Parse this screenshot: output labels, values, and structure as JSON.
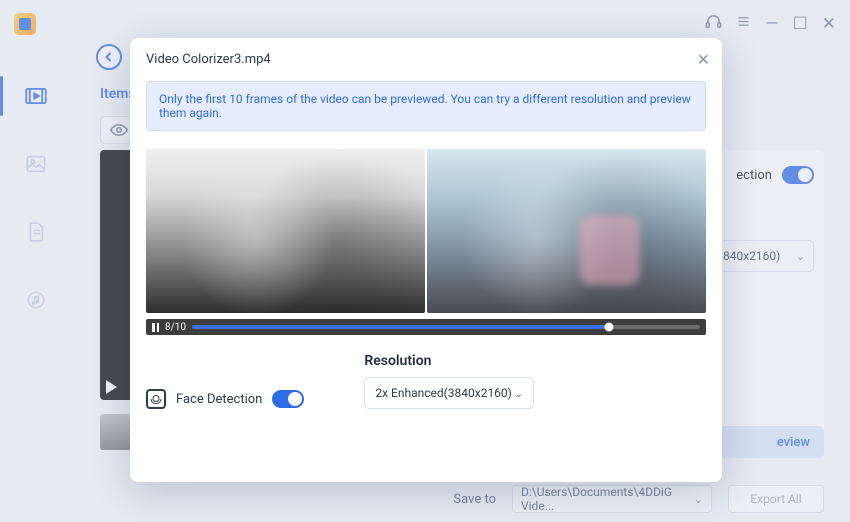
{
  "titlebar": {
    "min": "—",
    "max": "☐",
    "close": "✕"
  },
  "back": "<",
  "items_label": "Items",
  "right_panel": {
    "face_detection_partial": "ection",
    "resolution_partial": "840x2160)"
  },
  "preview_partial": "eview",
  "bottom": {
    "save_label": "Save to",
    "save_path": "D:\\Users\\Documents\\4DDiG Vide...",
    "export": "Export All"
  },
  "modal": {
    "title": "Video Colorizer3.mp4",
    "close": "✕",
    "banner": "Only the first 10 frames of the video can be previewed. You can try a different resolution and preview them again.",
    "frame_count": "8/10",
    "face_detection": "Face Detection",
    "resolution_label": "Resolution",
    "resolution_value": "2x Enhanced(3840x2160)"
  },
  "chevron": "⌄"
}
